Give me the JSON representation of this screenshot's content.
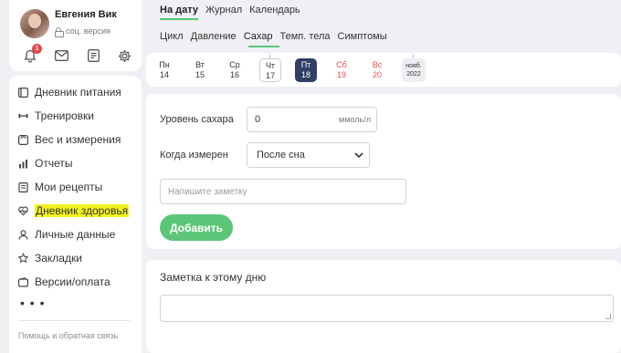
{
  "profile": {
    "name": "Евгения Вик",
    "version": "соц. версия",
    "notifications": "1"
  },
  "menu": [
    {
      "label": "Дневник питания",
      "icon": "food-diary-icon"
    },
    {
      "label": "Тренировки",
      "icon": "dumbbell-icon"
    },
    {
      "label": "Вес и измерения",
      "icon": "scale-icon"
    },
    {
      "label": "Отчеты",
      "icon": "bar-chart-icon"
    },
    {
      "label": "Мои рецепты",
      "icon": "recipe-book-icon"
    },
    {
      "label": "Дневник здоровья",
      "icon": "heart-pulse-icon",
      "highlighted": true
    },
    {
      "label": "Личные данные",
      "icon": "person-icon"
    },
    {
      "label": "Закладки",
      "icon": "star-icon"
    },
    {
      "label": "Версии/оплата",
      "icon": "wallet-icon"
    }
  ],
  "more": "• • •",
  "help": "Помощь и обратная связь",
  "tabs_top": [
    "На дату",
    "Журнал",
    "Календарь"
  ],
  "tabs_sub": [
    "Цикл",
    "Давление",
    "Сахар",
    "Темп. тела",
    "Симптомы"
  ],
  "days": [
    {
      "dow": "Пн",
      "num": "14"
    },
    {
      "dow": "Вт",
      "num": "15"
    },
    {
      "dow": "Ср",
      "num": "16"
    },
    {
      "dow": "Чт",
      "num": "17"
    },
    {
      "dow": "Пт",
      "num": "18"
    },
    {
      "dow": "Сб",
      "num": "19"
    },
    {
      "dow": "Вс",
      "num": "20"
    }
  ],
  "month_chip": {
    "month": "нояб.",
    "year": "2022"
  },
  "form": {
    "sugar_label": "Уровень сахара",
    "sugar_value": "0",
    "sugar_unit": "ммоль/л",
    "when_label": "Когда измерен",
    "when_value": "После сна",
    "note_placeholder": "Напишите заметку",
    "add_button": "Добавить"
  },
  "day_note": {
    "title": "Заметка к этому дню"
  },
  "colors": {
    "accent": "#5cc678",
    "selected_day": "#2f3f66",
    "weekend": "#e15050",
    "highlight": "#f4f21a"
  }
}
